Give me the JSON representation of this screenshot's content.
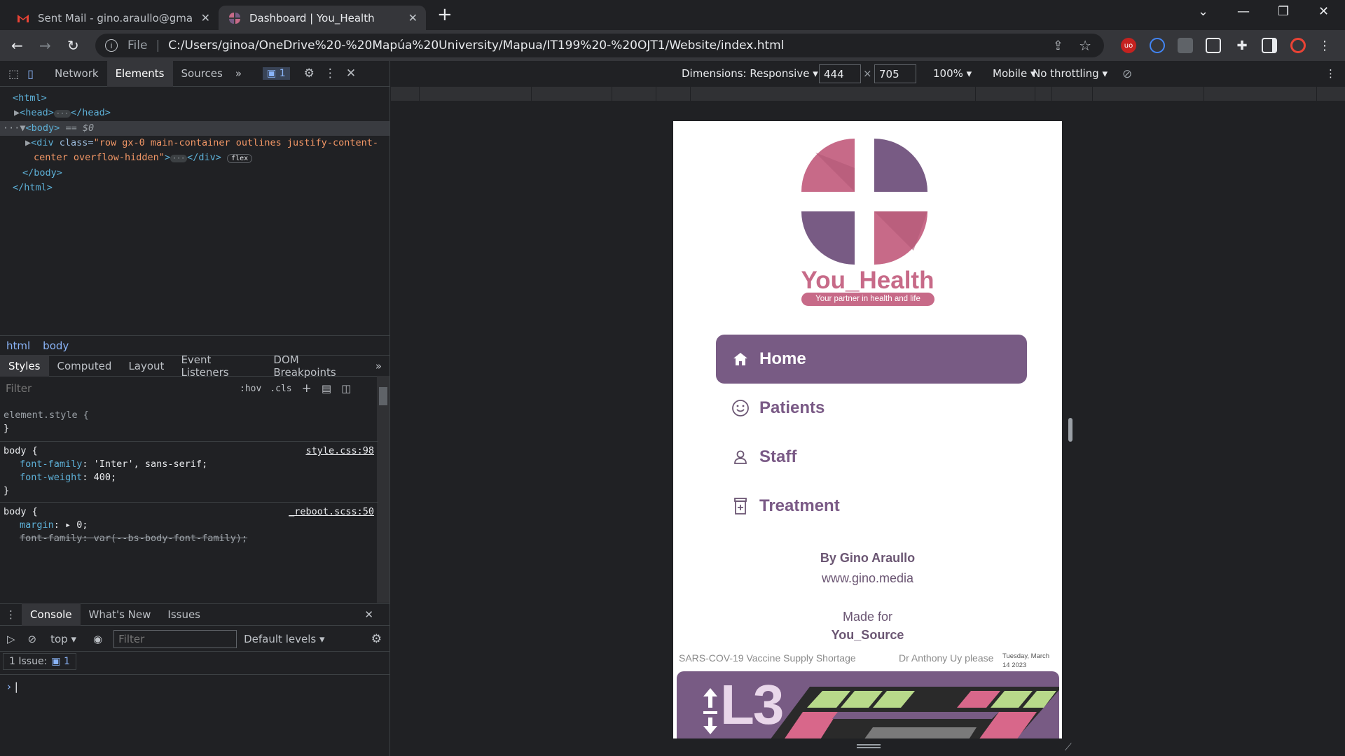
{
  "browser": {
    "tabs": [
      {
        "title": "Sent Mail - gino.araullo@gmail.c",
        "icon": "gmail-icon"
      },
      {
        "title": "Dashboard | You_Health",
        "icon": "you-health-icon"
      }
    ],
    "omnibox": {
      "scheme": "File",
      "url": "C:/Users/ginoa/OneDrive%20-%20Mapúa%20University/Mapua/IT199%20-%20OJT1/Website/index.html"
    }
  },
  "devtools": {
    "top_tabs": [
      "Network",
      "Elements",
      "Sources"
    ],
    "issue_count": "1",
    "tree": {
      "html_open": "<html>",
      "head": "<head>",
      "head_close": "</head>",
      "body_open": "<body>",
      "body_marker": "== $0",
      "div_line1_tag": "<div",
      "div_attr_name": "class=",
      "div_attr_value_1": "\"row gx-0 main-container outlines justify-content-",
      "div_attr_value_2": "center overflow-hidden\"",
      "div_close": "</div>",
      "flex_badge": "flex",
      "body_close": "</body>",
      "html_close": "</html>"
    },
    "breadcrumbs": [
      "html",
      "body"
    ],
    "styles_tabs": [
      "Styles",
      "Computed",
      "Layout",
      "Event Listeners",
      "DOM Breakpoints"
    ],
    "styles_filter_placeholder": "Filter",
    "hov": ":hov",
    "cls": ".cls",
    "rules": {
      "element_style": "element.style {",
      "close_brace": "}",
      "body_selector": "body {",
      "source1": "style.css:98",
      "p1_name": "font-family",
      "p1_value": "'Inter', sans-serif;",
      "p2_name": "font-weight",
      "p2_value": "400;",
      "source2": "_reboot.scss:50",
      "p3_name": "margin",
      "p3_value": "0;",
      "p4_name": "font-family",
      "p4_value": "var(--bs-body-font-family);"
    },
    "console_tabs": [
      "Console",
      "What's New",
      "Issues"
    ],
    "console_context": "top",
    "console_filter_placeholder": "Filter",
    "console_levels": "Default levels",
    "issues_label": "1 Issue:",
    "issues_count": "1"
  },
  "device_toolbar": {
    "dimensions": "Dimensions: Responsive",
    "width": "444",
    "height": "705",
    "times": "×",
    "zoom": "100%",
    "device": "Mobile",
    "throttling": "No throttling"
  },
  "page": {
    "brand_name": "You_Health",
    "brand_tagline": "Your partner in health and life",
    "nav": [
      {
        "label": "Home",
        "icon": "home-icon",
        "active": true
      },
      {
        "label": "Patients",
        "icon": "smiley-icon",
        "active": false
      },
      {
        "label": "Staff",
        "icon": "person-icon",
        "active": false
      },
      {
        "label": "Treatment",
        "icon": "medicine-bottle-icon",
        "active": false
      }
    ],
    "byline": "By Gino Araullo",
    "website": "www.gino.media",
    "made_for": "Made for",
    "made_for_name": "You_Source",
    "ticker_1": "SARS-COV-19 Vaccine Supply Shortage",
    "ticker_2": "Dr Anthony Uy please",
    "date_line1": "Tuesday, March",
    "date_line2": "14 2023",
    "banner_text": "L3",
    "colors": {
      "primary": "#785b84",
      "accent": "#c76a88"
    }
  }
}
